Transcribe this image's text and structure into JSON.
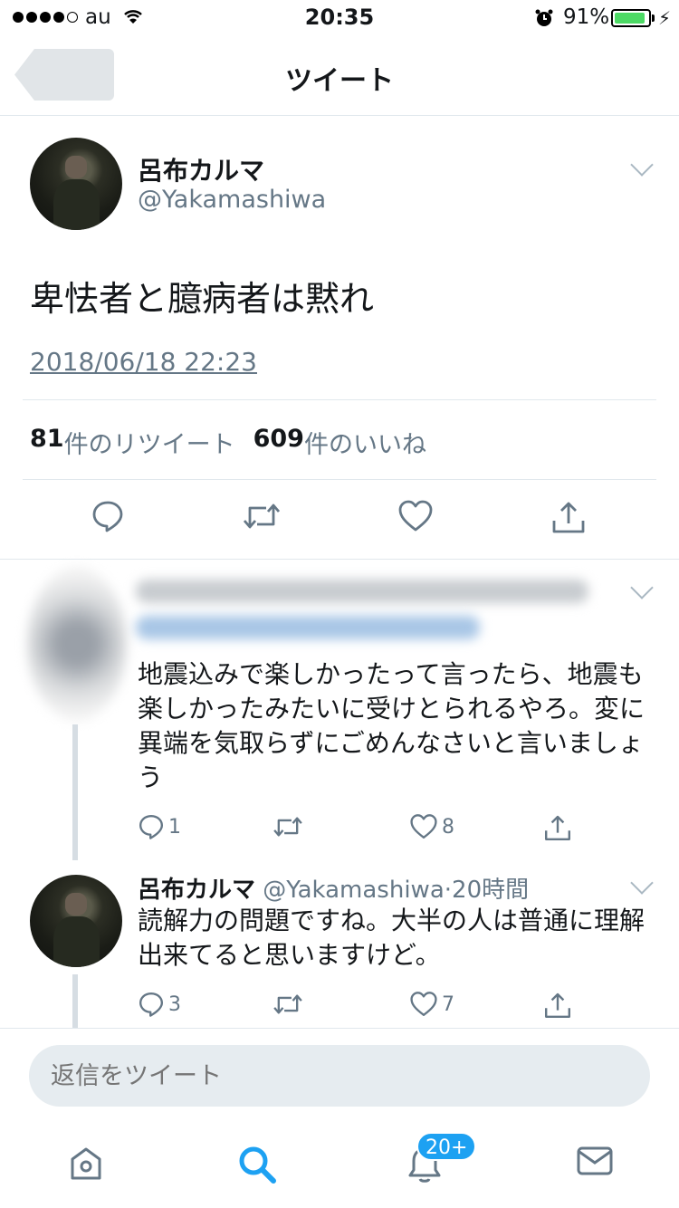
{
  "status_bar": {
    "carrier": "au",
    "time": "20:35",
    "battery_percent": "91%",
    "battery_level": 0.91
  },
  "nav": {
    "title": "ツイート"
  },
  "tweet": {
    "display_name": "呂布カルマ",
    "handle": "@Yakamashiwa",
    "text": "卑怯者と臆病者は黙れ",
    "timestamp": "2018/06/18 22:23",
    "retweet_count": "81",
    "retweet_label": "件のリツイート",
    "like_count": "609",
    "like_label": "件のいいね"
  },
  "replies": [
    {
      "text": "地震込みで楽しかったって言ったら、地震も楽しかったみたいに受けとられるやろ。変に異端を気取らずにごめんなさいと言いましょう",
      "reply_count": "1",
      "retweet_count": "",
      "like_count": "8"
    },
    {
      "display_name": "呂布カルマ",
      "handle": "@Yakamashiwa",
      "separator": "·",
      "time": "20時間",
      "text": "読解力の問題ですね。大半の人は普通に理解出来てると思いますけど。",
      "reply_count": "3",
      "retweet_count": "",
      "like_count": "7"
    }
  ],
  "composer": {
    "placeholder": "返信をツイート"
  },
  "tabbar": {
    "notifications_badge": "20+"
  },
  "colors": {
    "accent": "#1da1f2",
    "muted": "#657786",
    "battery": "#4cd964"
  }
}
